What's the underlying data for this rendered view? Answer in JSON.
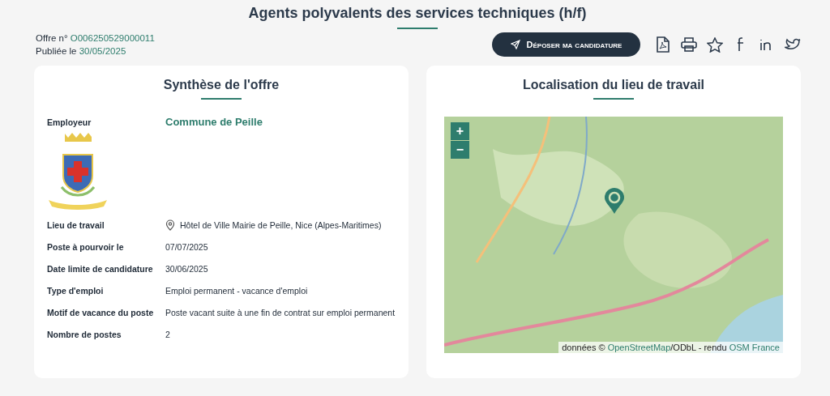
{
  "page_title": "Agents polyvalents des services techniques (h/f)",
  "offer": {
    "number_label": "Offre n°",
    "number": "O006250529000011",
    "published_label": "Publiée le",
    "published": "30/05/2025"
  },
  "apply_button": "Déposer ma candidature",
  "share_icons": [
    {
      "kind": "pdf"
    },
    {
      "kind": "print"
    },
    {
      "kind": "star"
    },
    {
      "kind": "facebook"
    },
    {
      "kind": "linkedin"
    },
    {
      "kind": "twitter"
    }
  ],
  "summary": {
    "title": "Synthèse de l'offre",
    "rows": [
      {
        "kind": "employer",
        "label": "Employeur",
        "value": "Commune de Peille"
      },
      {
        "kind": "place",
        "label": "Lieu de travail",
        "value": "Hôtel de Ville Mairie de Peille, Nice (Alpes-Maritimes)"
      },
      {
        "kind": "text",
        "label": "Poste à pourvoir le",
        "value": "07/07/2025"
      },
      {
        "kind": "text",
        "label": "Date limite de candidature",
        "value": "30/06/2025"
      },
      {
        "kind": "text",
        "label": "Type d'emploi",
        "value": "Emploi permanent - vacance d'emploi"
      },
      {
        "kind": "text",
        "label": "Motif de vacance du poste",
        "value": "Poste vacant suite à une fin de contrat sur emploi permanent"
      },
      {
        "kind": "text",
        "label": "Nombre de postes",
        "value": "2"
      }
    ]
  },
  "location": {
    "title": "Localisation du lieu de travail",
    "zoom_in": "+",
    "zoom_out": "−",
    "attribution": [
      {
        "text": "données © ",
        "link": false
      },
      {
        "text": "OpenStreetMap",
        "link": true
      },
      {
        "text": "/ODbL - rendu ",
        "link": false
      },
      {
        "text": "OSM France",
        "link": true
      }
    ]
  }
}
